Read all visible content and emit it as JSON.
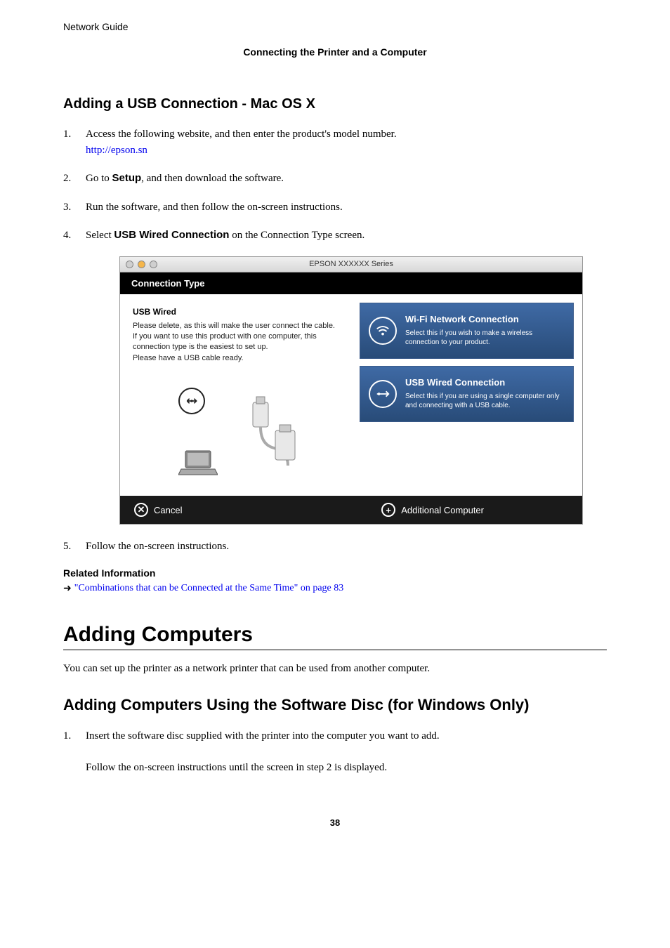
{
  "header": {
    "guide_name": "Network Guide",
    "section": "Connecting the Printer and a Computer"
  },
  "section1": {
    "title": "Adding a USB Connection - Mac OS X",
    "steps": {
      "s1_pre": "Access the following website, and then enter the product's model number.",
      "s1_link": "http://epson.sn",
      "s2_pre": "Go to ",
      "s2_bold": "Setup",
      "s2_post": ", and then download the software.",
      "s3": "Run the software, and then follow the on-screen instructions.",
      "s4_pre": "Select ",
      "s4_bold": "USB Wired Connection",
      "s4_post": " on the Connection Type screen.",
      "s5": "Follow the on-screen instructions."
    }
  },
  "screenshot": {
    "window_title": "EPSON XXXXXX Series",
    "header": "Connection Type",
    "left": {
      "title": "USB Wired",
      "desc": "Please delete, as this will make the user connect the cable.\nIf you want to use this product with one computer, this connection type is the easiest to set up.\nPlease have a USB cable ready."
    },
    "options": {
      "wifi": {
        "title": "Wi-Fi Network Connection",
        "sub": "Select this if you wish to make a wireless connection to your product."
      },
      "usb": {
        "title": "USB Wired Connection",
        "sub": "Select this if you are using a single computer only and connecting with a USB cable."
      }
    },
    "footer": {
      "cancel": "Cancel",
      "additional": "Additional Computer"
    }
  },
  "related": {
    "heading": "Related Information",
    "link": "\"Combinations that can be Connected at the Same Time\" on page 83"
  },
  "section2": {
    "title": "Adding Computers",
    "intro": "You can set up the printer as a network printer that can be used from another computer.",
    "sub_title": "Adding Computers Using the Software Disc (for Windows Only)",
    "steps": {
      "s1_line1": "Insert the software disc supplied with the printer into the computer you want to add.",
      "s1_line2": "Follow the on-screen instructions until the screen in step 2 is displayed."
    }
  },
  "page_number": "38"
}
